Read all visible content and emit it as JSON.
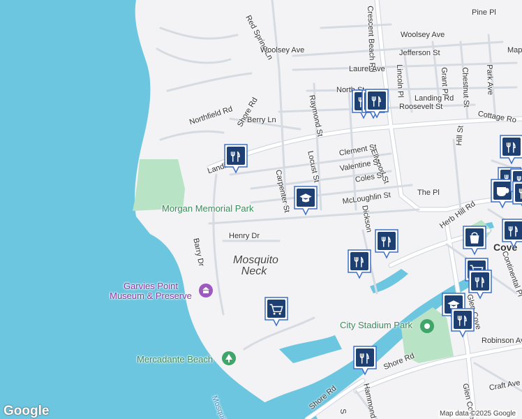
{
  "map": {
    "attribution": "Map data ©2025 Google",
    "logo": "Google",
    "colors": {
      "water": "#6cc6e0",
      "land": "#f3f3f6",
      "road": "#ffffff",
      "road_outline": "#cdd3dc",
      "park": "#b9e3c5",
      "poi": "#8b3aa6",
      "marker_blue": "#1a73e8"
    },
    "street_labels": [
      "Red Spring Ln",
      "Crescent Beach Rd",
      "Pine Pl",
      "Woolsey Ave",
      "Map",
      "Woolsey Ave",
      "Jefferson St",
      "Laurel Ave",
      "Lincoln Pl",
      "Grant Pl",
      "Chestnut St",
      "Park Ave",
      "North St",
      "Roosevelt St",
      "Raymond St",
      "Berry Ln",
      "Cottage Ro",
      "Northfield Rd",
      "Shore Rd",
      "Landing Rd",
      "Clement St",
      "Ellwood St",
      "Hill St",
      "Locust St",
      "Valentine St",
      "Landing Rd",
      "Carpenter St",
      "Coles St",
      "The Pl",
      "McLoughlin St",
      "Dickson",
      "Herb Hill Rd",
      "Henry Dr",
      "Barry Dr",
      "Continental Pl",
      "Glen Cove",
      "Robinson Ave",
      "Shore Rd",
      "Hammond",
      "Glen Cove Ave",
      "Craft Ave",
      "Shore Rd",
      "S",
      "Cove"
    ],
    "park_labels": [
      "Morgan Memorial Park",
      "City Stadium Park",
      "Mercadante Beach"
    ],
    "poi_labels": [
      "Garvies Point Museum & Preserve"
    ],
    "area_labels": [
      "Mosquito Neck"
    ],
    "water_labels": [
      "Mosquito"
    ],
    "markers": [
      {
        "type": "restaurant",
        "icon": "fork-knife-icon"
      },
      {
        "type": "restaurant",
        "icon": "fork-knife-icon"
      },
      {
        "type": "restaurant",
        "icon": "fork-knife-icon"
      },
      {
        "type": "restaurant",
        "icon": "fork-knife-icon"
      },
      {
        "type": "school",
        "icon": "graduation-cap-icon"
      },
      {
        "type": "restaurant",
        "icon": "fork-knife-icon"
      },
      {
        "type": "restaurant",
        "icon": "fork-knife-icon"
      },
      {
        "type": "grocery",
        "icon": "shopping-cart-icon"
      },
      {
        "type": "restaurant",
        "icon": "fork-knife-icon"
      },
      {
        "type": "restaurant",
        "icon": "fork-knife-icon"
      },
      {
        "type": "cafe",
        "icon": "coffee-cup-icon"
      },
      {
        "type": "restaurant",
        "icon": "fork-knife-icon"
      },
      {
        "type": "shopping",
        "icon": "shopping-bag-icon"
      },
      {
        "type": "grocery",
        "icon": "shopping-cart-icon"
      },
      {
        "type": "restaurant",
        "icon": "fork-knife-icon"
      },
      {
        "type": "school",
        "icon": "graduation-cap-icon"
      },
      {
        "type": "restaurant",
        "icon": "fork-knife-icon"
      },
      {
        "type": "restaurant",
        "icon": "fork-knife-icon"
      },
      {
        "type": "restaurant",
        "icon": "fork-knife-icon"
      },
      {
        "type": "restaurant",
        "icon": "fork-knife-icon"
      }
    ]
  }
}
